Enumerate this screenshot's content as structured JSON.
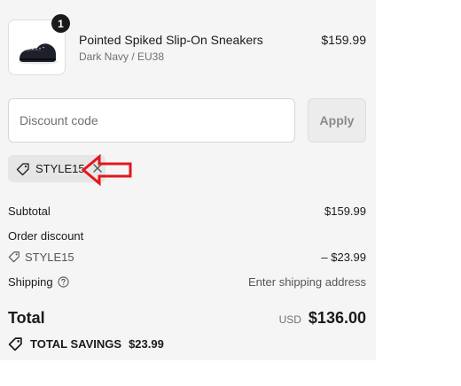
{
  "product": {
    "quantity": "1",
    "name": "Pointed Spiked Slip-On Sneakers",
    "variant": "Dark Navy / EU38",
    "price": "$159.99",
    "image_icon": "shoe-thumbnail"
  },
  "discount": {
    "placeholder": "Discount code",
    "apply_label": "Apply",
    "applied_code": "STYLE15"
  },
  "summary": {
    "subtotal_label": "Subtotal",
    "subtotal_value": "$159.99",
    "order_discount_label": "Order discount",
    "discount_code": "STYLE15",
    "discount_value": "– $23.99",
    "shipping_label": "Shipping",
    "shipping_value": "Enter shipping address",
    "total_label": "Total",
    "total_currency": "USD",
    "total_value": "$136.00",
    "savings_label": "TOTAL SAVINGS",
    "savings_value": "$23.99"
  },
  "colors": {
    "panel_bg": "#f5f5f5",
    "arrow": "#e3161b",
    "text": "#1a1a1a"
  }
}
